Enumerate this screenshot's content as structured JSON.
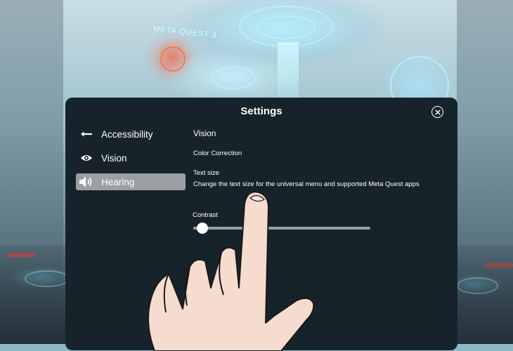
{
  "background": {
    "logo_text": "META QUEST 3"
  },
  "settings": {
    "title": "Settings",
    "close_icon": "close-circle-icon",
    "nav": [
      {
        "label": "Accessibility",
        "icon": "back-arrow-icon",
        "active": false
      },
      {
        "label": "Vision",
        "icon": "eye-icon",
        "active": false
      },
      {
        "label": "Hearing",
        "icon": "speaker-icon",
        "active": true
      }
    ],
    "content": {
      "heading": "Vision",
      "color_correction": "Color Correction",
      "text_size_label": "Text size",
      "text_size_desc": "Change the text size for the universal menu and supported Meta Quest apps",
      "contrast_label": "Contrast",
      "contrast_value_fraction": 0.05
    }
  },
  "colors": {
    "panel_bg": "#17232b",
    "active_item_bg": "#9aa0a4",
    "slider_track": "#9aa0a4",
    "text": "#ffffff"
  }
}
